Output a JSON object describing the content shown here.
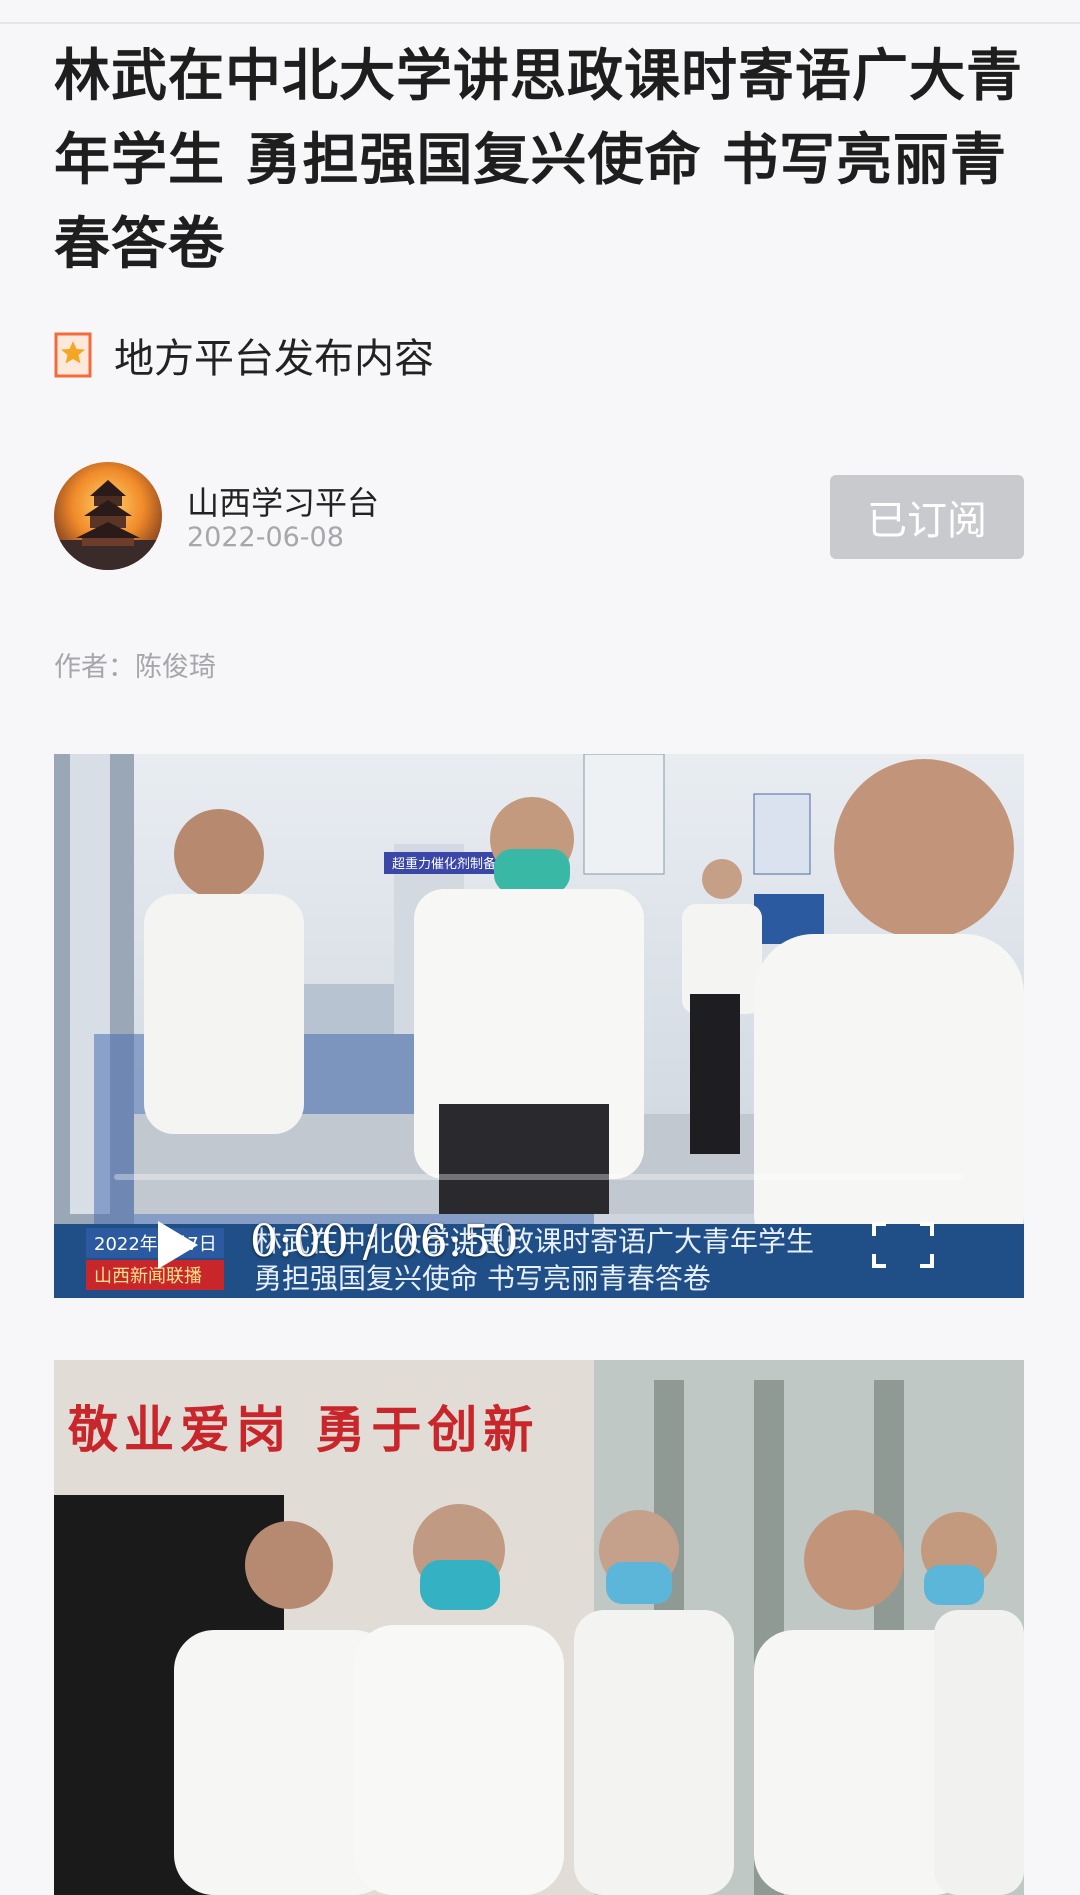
{
  "article": {
    "title": "林武在中北大学讲思政课时寄语广大青年学生 勇担强国复兴使命 书写亮丽青春答卷",
    "platform_tag": "地方平台发布内容"
  },
  "publisher": {
    "name": "山西学习平台",
    "date": "2022-06-08",
    "subscribe_label": "已订阅"
  },
  "author_line": "作者：陈俊琦",
  "video": {
    "time": "0:00 / 06:50",
    "progress": 0,
    "caption_line1": "林武在中北大学讲思政课时寄语广大青年学生",
    "caption_line2": "勇担强国复兴使命 书写亮丽青春答卷",
    "news_date": "2022年6月7日",
    "news_program": "山西新闻联播",
    "lab_sign": "超重力催化剂制备装置"
  },
  "photo": {
    "banner_text": "敬业爱岗  勇于创新"
  },
  "colors": {
    "background": "#f7f7f9",
    "subscribed_button": "#c9cacd",
    "muted_text": "#a6a6ab",
    "caption_bar": "#1f4f86",
    "banner_red": "#c8262b"
  },
  "icons": {
    "platform_tag": "star-bookmark-icon",
    "play": "play-icon",
    "fullscreen": "fullscreen-icon"
  }
}
